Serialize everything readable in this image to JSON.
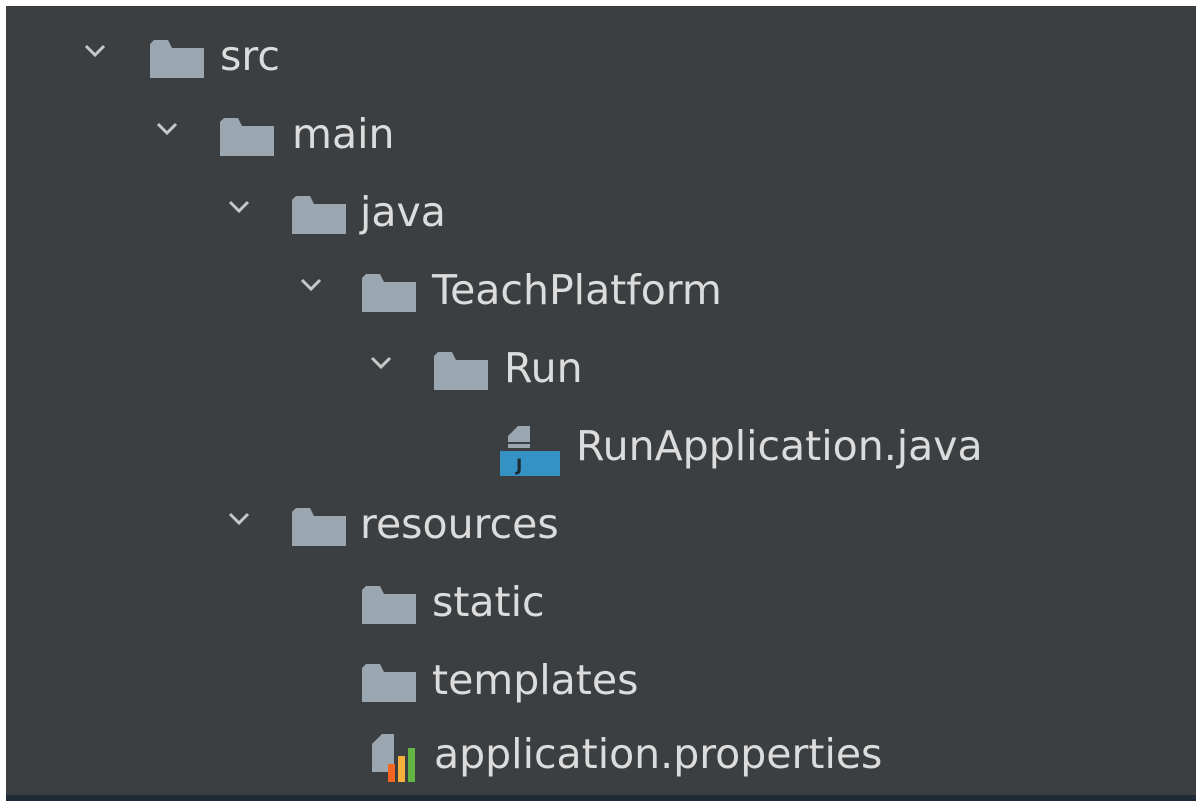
{
  "project_tree": {
    "items": [
      {
        "label": "src",
        "expanded": true,
        "icon": "folder-icon"
      },
      {
        "label": "main",
        "expanded": true,
        "icon": "folder-icon"
      },
      {
        "label": "java",
        "expanded": true,
        "icon": "folder-icon"
      },
      {
        "label": "TeachPlatform",
        "expanded": true,
        "icon": "folder-icon"
      },
      {
        "label": "Run",
        "expanded": true,
        "icon": "folder-icon"
      },
      {
        "label": "RunApplication.java",
        "icon": "java-class-file-icon"
      },
      {
        "label": "resources",
        "expanded": true,
        "icon": "folder-icon"
      },
      {
        "label": "static",
        "icon": "folder-icon"
      },
      {
        "label": "templates",
        "icon": "folder-icon"
      },
      {
        "label": "application.properties",
        "icon": "properties-file-icon"
      }
    ]
  },
  "colors": {
    "panel_background": "#3c3f41",
    "text": "#dcdcdc",
    "folder": "#9aa7b0",
    "java_file_accent": "#3592c4",
    "properties_bars": [
      "#f26522",
      "#f4af3d",
      "#62b543"
    ]
  }
}
